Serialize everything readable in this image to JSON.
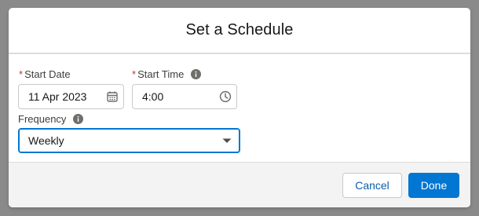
{
  "modal": {
    "title": "Set a Schedule"
  },
  "form": {
    "start_date": {
      "required_marker": "*",
      "label": "Start Date",
      "value": "11 Apr 2023",
      "icon": "calendar-icon"
    },
    "start_time": {
      "required_marker": "*",
      "label": "Start Time",
      "value": "4:00",
      "icon": "clock-icon",
      "info_icon": "info-icon"
    },
    "frequency": {
      "label": "Frequency",
      "value": "Weekly",
      "icon": "chevron-down-icon",
      "info_icon": "info-icon"
    }
  },
  "footer": {
    "cancel_label": "Cancel",
    "done_label": "Done"
  },
  "colors": {
    "brand": "#0176d3",
    "required": "#c23934",
    "overlay": "#8a8a8a"
  }
}
